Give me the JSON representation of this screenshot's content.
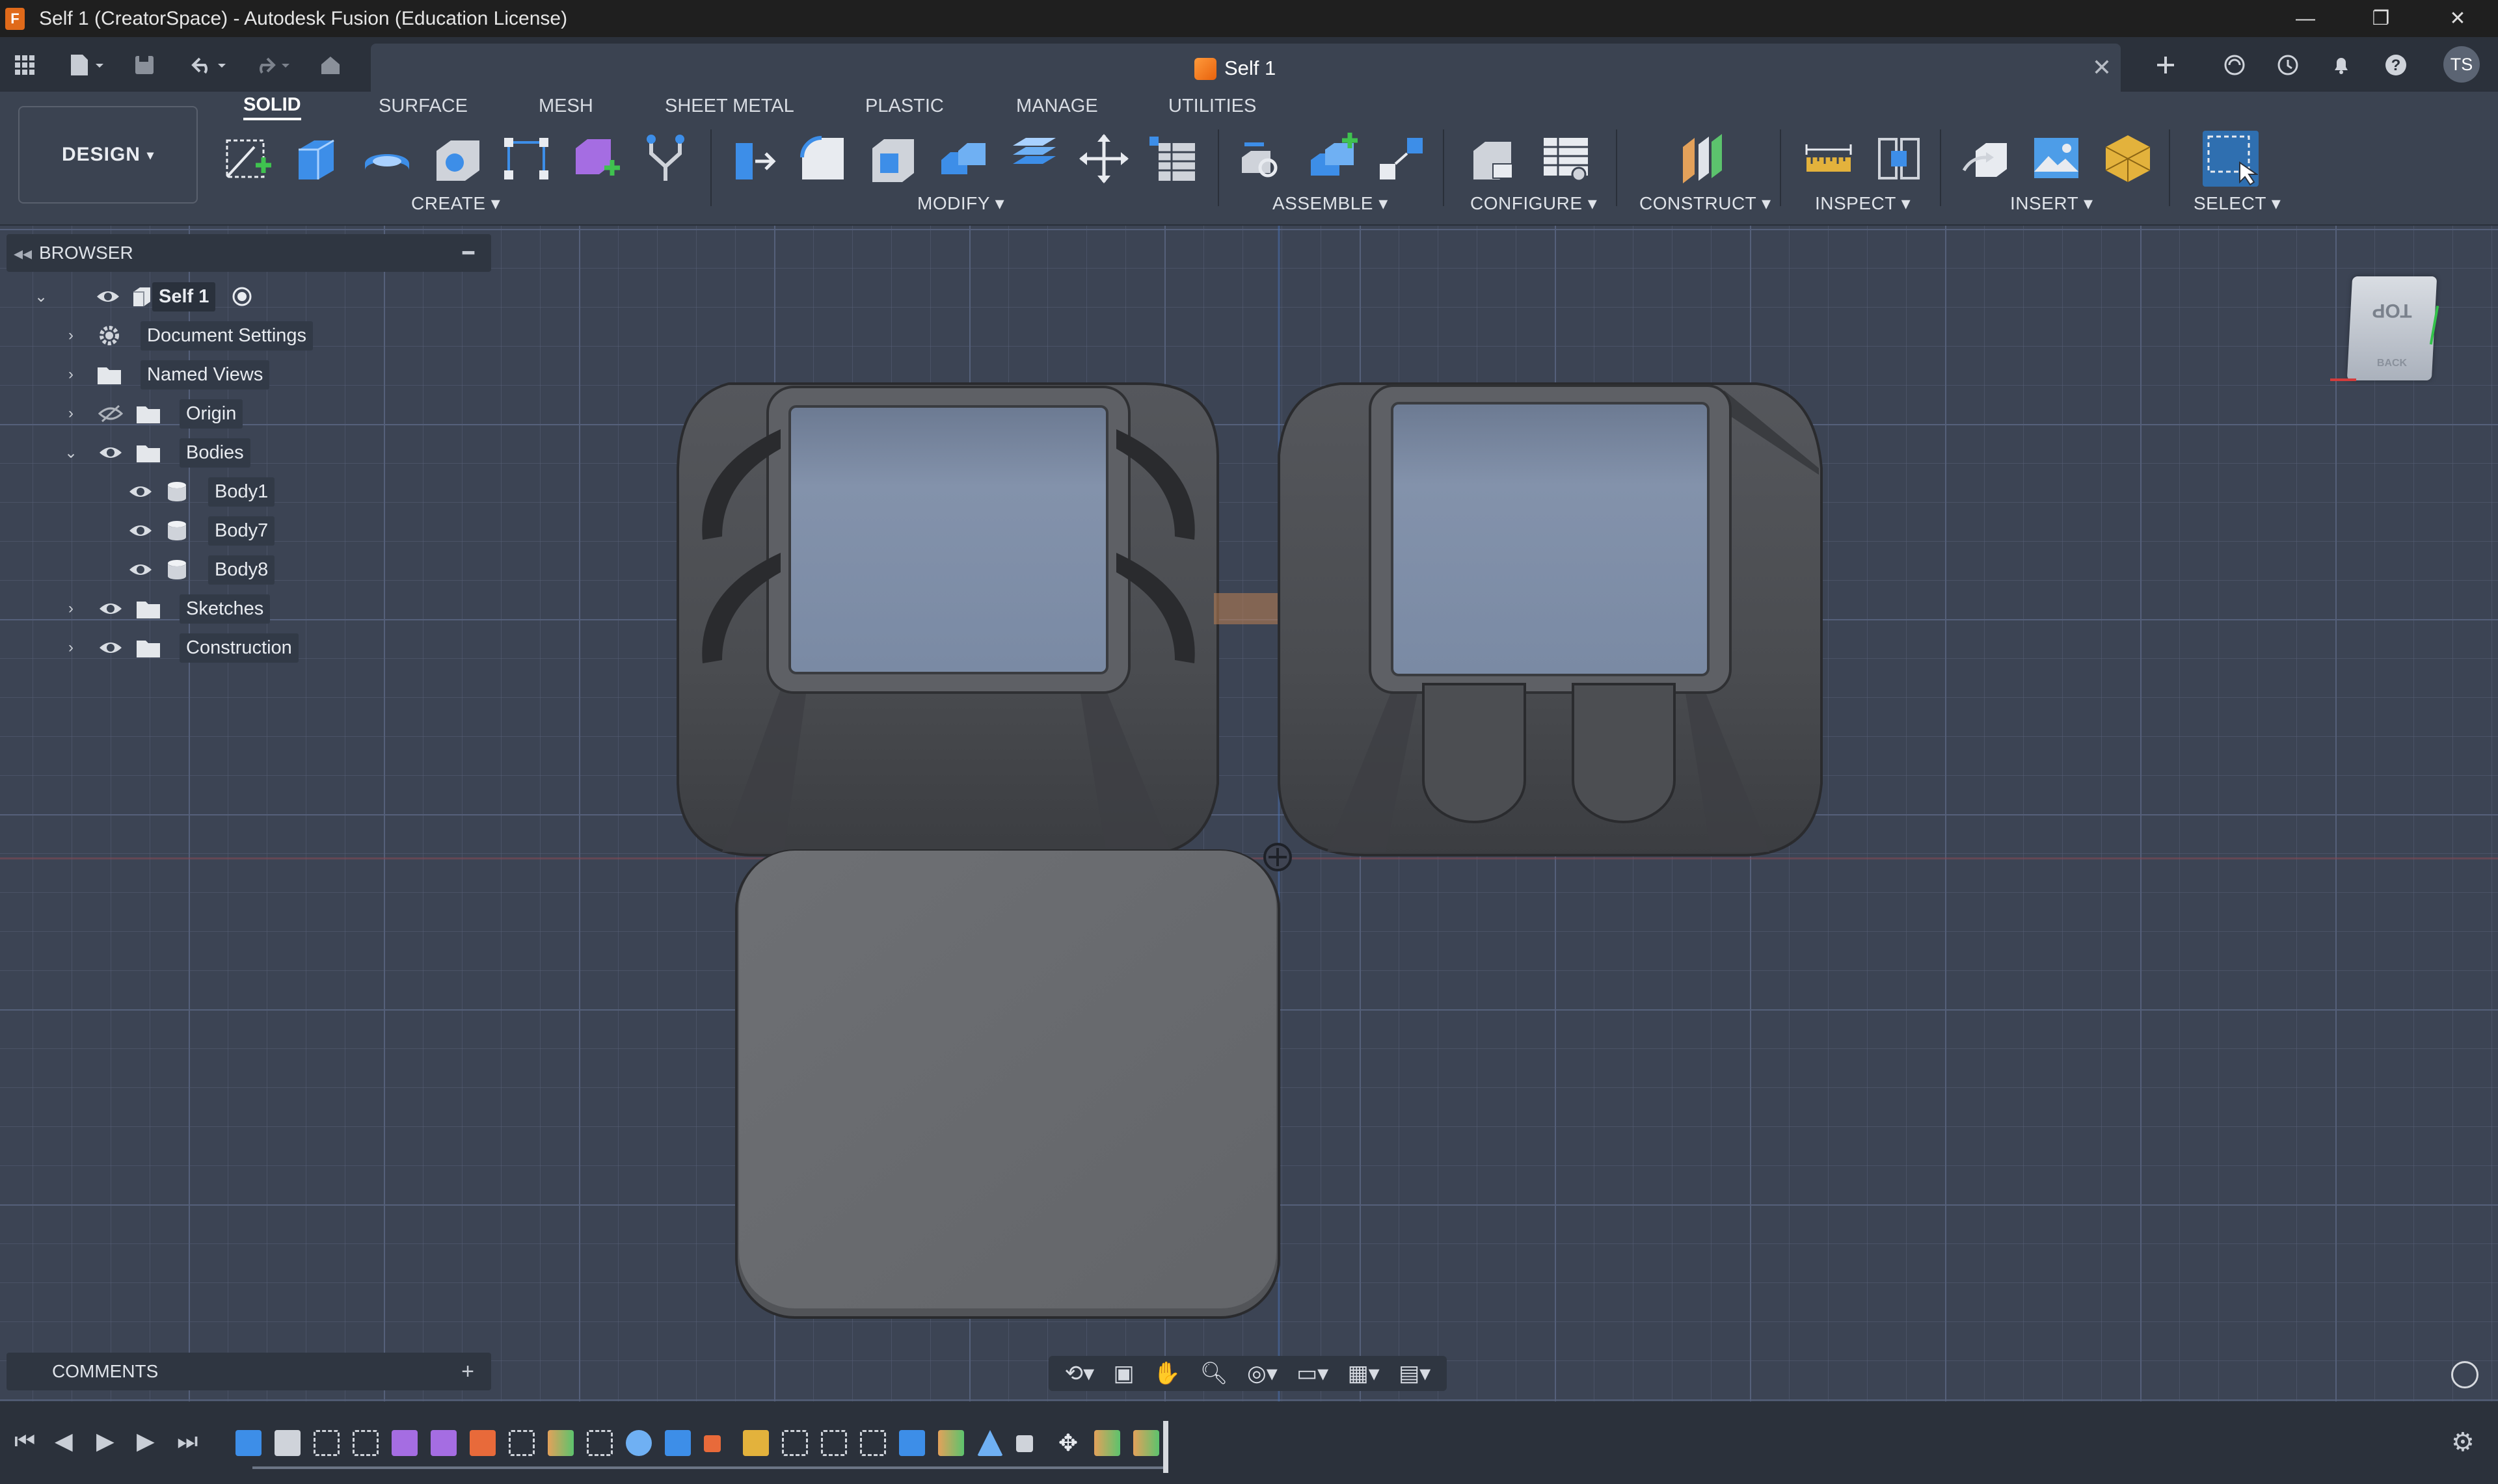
{
  "window": {
    "title": "Self 1 (CreatorSpace) - Autodesk Fusion (Education License)",
    "app_icon": "F",
    "controls": [
      "—",
      "❐",
      "✕"
    ]
  },
  "appbar": {
    "tab_title": "Self 1",
    "avatar_initials": "TS"
  },
  "ribbon": {
    "workspace": "DESIGN",
    "tabs": [
      "SOLID",
      "SURFACE",
      "MESH",
      "SHEET METAL",
      "PLASTIC",
      "MANAGE",
      "UTILITIES"
    ],
    "active_tab": "SOLID",
    "groups": {
      "create": "CREATE",
      "modify": "MODIFY",
      "assemble": "ASSEMBLE",
      "configure": "CONFIGURE",
      "construct": "CONSTRUCT",
      "inspect": "INSPECT",
      "insert": "INSERT",
      "select": "SELECT"
    }
  },
  "browser": {
    "title": "BROWSER",
    "root": "Self 1",
    "items": [
      {
        "label": "Document Settings"
      },
      {
        "label": "Named Views"
      },
      {
        "label": "Origin"
      },
      {
        "label": "Bodies"
      },
      {
        "label": "Body1"
      },
      {
        "label": "Body7"
      },
      {
        "label": "Body8"
      },
      {
        "label": "Sketches"
      },
      {
        "label": "Construction"
      }
    ]
  },
  "comments": {
    "title": "COMMENTS"
  },
  "viewcube": {
    "top_label": "TOP",
    "back_label": "BACK"
  },
  "colors": {
    "accent": "#e8620d",
    "body_dark": "#4b4d52",
    "body_face": "#6a6c70",
    "glass": "#7b8aa3",
    "viewport_bg": "#3c4454"
  }
}
